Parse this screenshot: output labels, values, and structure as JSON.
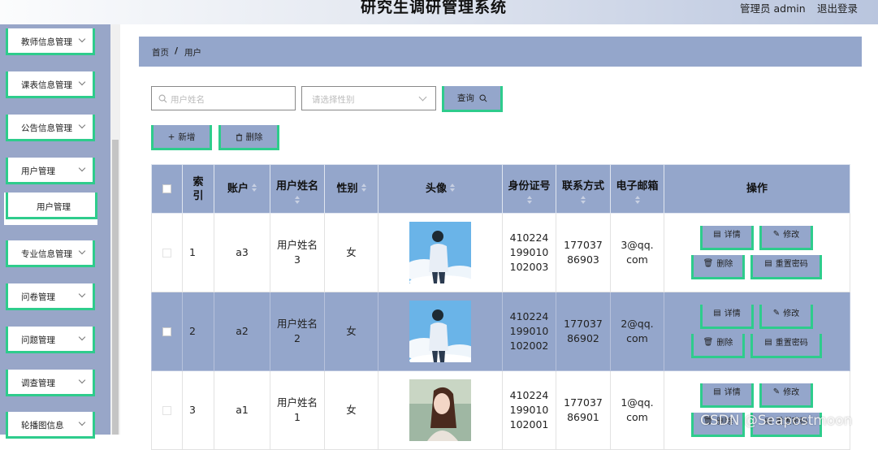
{
  "header": {
    "title": "研究生调研管理系统",
    "user_label": "管理员 admin",
    "logout_label": "退出登录"
  },
  "sidebar": {
    "items": [
      {
        "label": "教师信息管理"
      },
      {
        "label": "课表信息管理"
      },
      {
        "label": "公告信息管理"
      },
      {
        "label": "用户管理"
      },
      {
        "label": "专业信息管理"
      },
      {
        "label": "问卷管理"
      },
      {
        "label": "问题管理"
      },
      {
        "label": "调查管理"
      },
      {
        "label": "轮播图信息"
      }
    ],
    "active_sub": {
      "label": "用户管理"
    }
  },
  "breadcrumb": {
    "home": "首页",
    "separator": "/",
    "current": "用户"
  },
  "search": {
    "name_placeholder": "用户姓名",
    "gender_placeholder": "请选择性别",
    "query_label": "查询"
  },
  "actions": {
    "add_label": "新增",
    "delete_label": "删除"
  },
  "table": {
    "columns": {
      "index": "索引",
      "account": "账户",
      "name": "用户姓名",
      "gender": "性别",
      "avatar": "头像",
      "id_card": "身份证号",
      "phone": "联系方式",
      "email": "电子邮箱",
      "ops": "操作"
    },
    "rows": [
      {
        "index": "1",
        "account": "a3",
        "name": "用户姓名3",
        "gender": "女",
        "id_card": "410224199010102003",
        "phone": "17703786903",
        "email": "3@qq.com"
      },
      {
        "index": "2",
        "account": "a2",
        "name": "用户姓名2",
        "gender": "女",
        "id_card": "410224199010102002",
        "phone": "17703786902",
        "email": "2@qq.com"
      },
      {
        "index": "3",
        "account": "a1",
        "name": "用户姓名1",
        "gender": "女",
        "id_card": "410224199010102001",
        "phone": "17703786901",
        "email": "1@qq.com"
      }
    ],
    "op_labels": {
      "detail": "详情",
      "edit": "修改",
      "delete": "删除",
      "reset": "重置密码"
    }
  },
  "watermark": "CSDN @Seapostmoon",
  "colors": {
    "accent_green": "#2ecc8c",
    "accent_blue": "#94a6cb"
  }
}
